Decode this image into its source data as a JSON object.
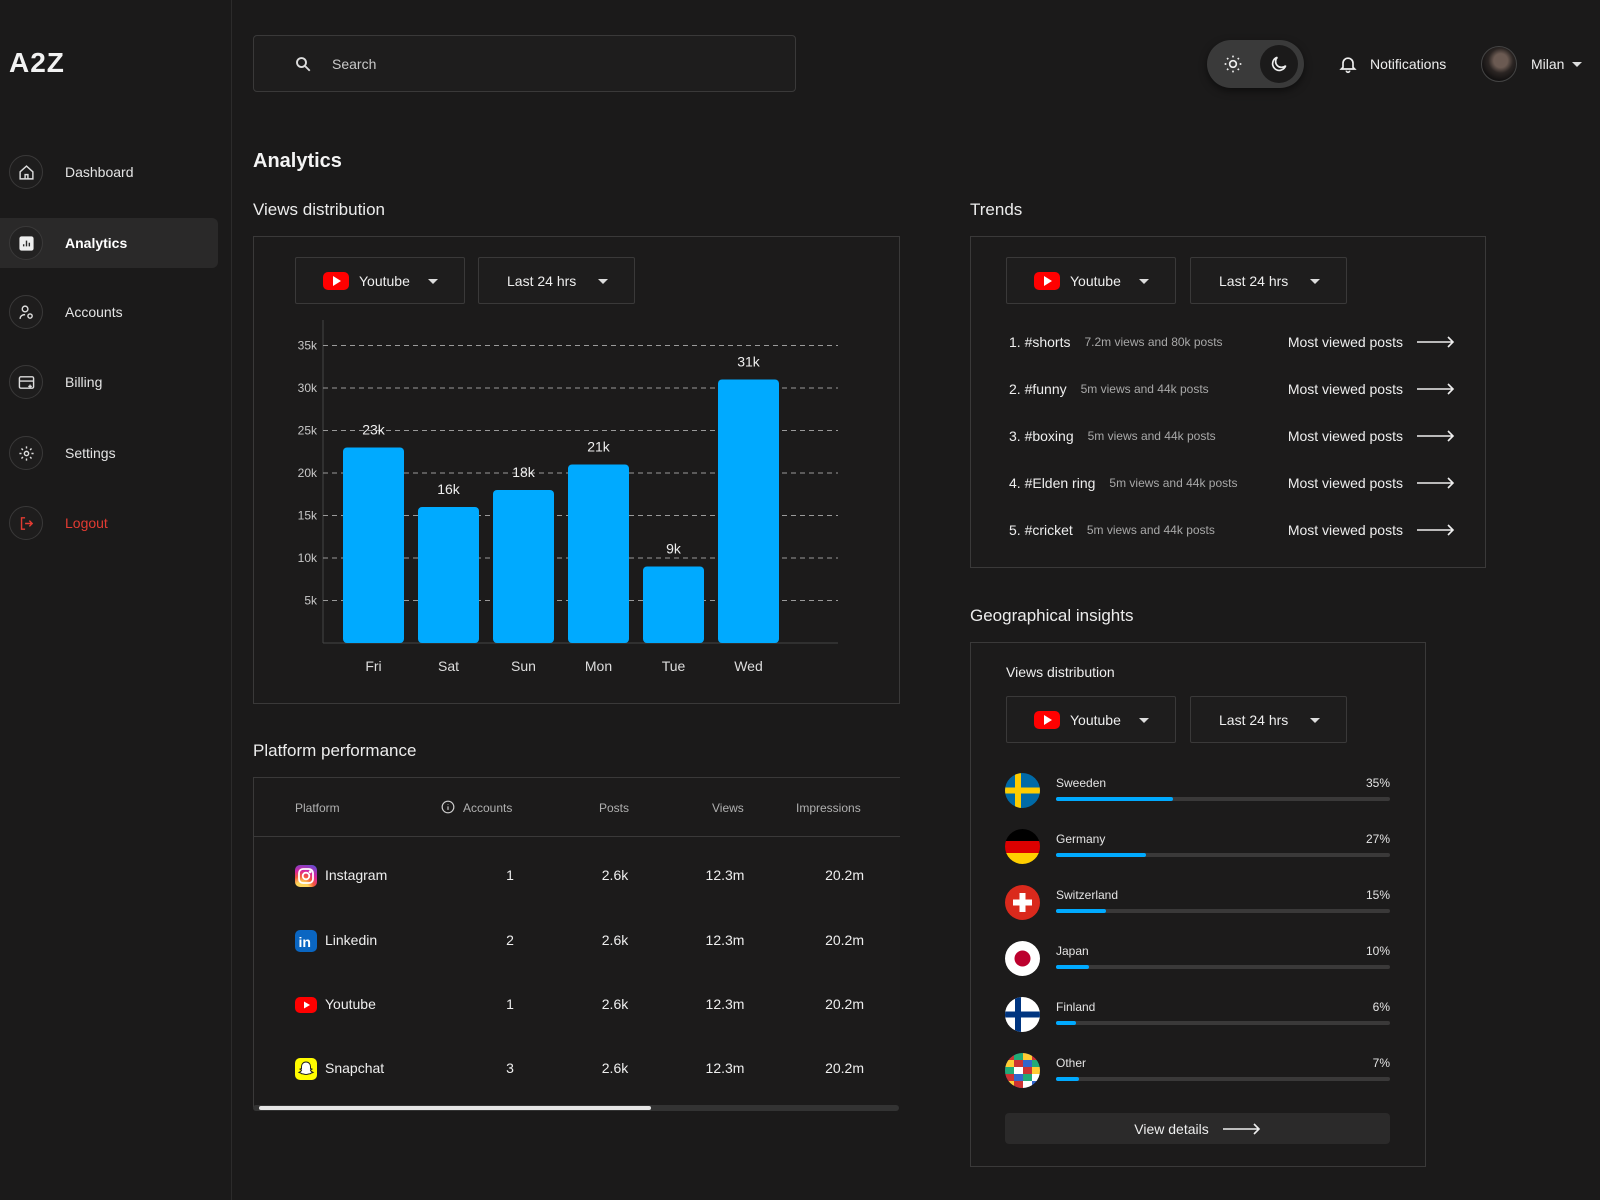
{
  "app": {
    "logo": "A2Z"
  },
  "sidebar": {
    "items": [
      {
        "label": "Dashboard",
        "icon": "home-icon"
      },
      {
        "label": "Analytics",
        "icon": "chart-icon",
        "active": true
      },
      {
        "label": "Accounts",
        "icon": "user-gear-icon"
      },
      {
        "label": "Billing",
        "icon": "card-icon"
      },
      {
        "label": "Settings",
        "icon": "gear-icon"
      },
      {
        "label": "Logout",
        "icon": "logout-icon",
        "color": "#e23b32"
      }
    ]
  },
  "header": {
    "search_placeholder": "Search",
    "notifications_label": "Notifications",
    "user_name": "Milan",
    "theme": "dark"
  },
  "page": {
    "title": "Analytics"
  },
  "views": {
    "title": "Views distribution",
    "platform_select": "Youtube",
    "range_select": "Last 24 hrs"
  },
  "chart_data": {
    "type": "bar",
    "categories": [
      "Fri",
      "Sat",
      "Sun",
      "Mon",
      "Tue",
      "Wed"
    ],
    "values": [
      23,
      16,
      18,
      21,
      9,
      31
    ],
    "data_labels": [
      "23k",
      "16k",
      "18k",
      "21k",
      "9k",
      "31k"
    ],
    "yticks": [
      5,
      10,
      15,
      20,
      25,
      30,
      35
    ],
    "ytick_labels": [
      "5k",
      "10k",
      "15k",
      "20k",
      "25k",
      "30k",
      "35k"
    ],
    "ylim": [
      0,
      38
    ],
    "grid": true,
    "bar_color": "#00aaff"
  },
  "trends": {
    "title": "Trends",
    "platform_select": "Youtube",
    "range_select": "Last 24 hrs",
    "link_label": "Most viewed posts",
    "items": [
      {
        "tag": "1. #shorts",
        "meta": "7.2m views and 80k posts"
      },
      {
        "tag": "2. #funny",
        "meta": "5m views and 44k posts"
      },
      {
        "tag": "3. #boxing",
        "meta": "5m views and 44k posts"
      },
      {
        "tag": "4. #Elden ring",
        "meta": "5m views and 44k posts"
      },
      {
        "tag": "5. #cricket",
        "meta": "5m views and 44k posts"
      }
    ]
  },
  "platform": {
    "title": "Platform performance",
    "headers": [
      "Platform",
      "Accounts",
      "Posts",
      "Views",
      "Impressions"
    ],
    "rows": [
      {
        "name": "Instagram",
        "icon": "instagram-icon",
        "accounts": "1",
        "posts": "2.6k",
        "views": "12.3m",
        "impressions": "20.2m"
      },
      {
        "name": "Linkedin",
        "icon": "linkedin-icon",
        "accounts": "2",
        "posts": "2.6k",
        "views": "12.3m",
        "impressions": "20.2m"
      },
      {
        "name": "Youtube",
        "icon": "youtube-icon",
        "accounts": "1",
        "posts": "2.6k",
        "views": "12.3m",
        "impressions": "20.2m"
      },
      {
        "name": "Snapchat",
        "icon": "snapchat-icon",
        "accounts": "3",
        "posts": "2.6k",
        "views": "12.3m",
        "impressions": "20.2m"
      }
    ]
  },
  "geo": {
    "title": "Geographical insights",
    "subtitle": "Views distribution",
    "platform_select": "Youtube",
    "range_select": "Last 24 hrs",
    "countries": [
      {
        "name": "Sweeden",
        "pct_label": "35%",
        "pct": 35,
        "flag": "sweden-flag"
      },
      {
        "name": "Germany",
        "pct_label": "27%",
        "pct": 27,
        "flag": "germany-flag"
      },
      {
        "name": "Switzerland",
        "pct_label": "15%",
        "pct": 15,
        "flag": "switzerland-flag"
      },
      {
        "name": "Japan",
        "pct_label": "10%",
        "pct": 10,
        "flag": "japan-flag"
      },
      {
        "name": "Finland",
        "pct_label": "6%",
        "pct": 6,
        "flag": "finland-flag"
      },
      {
        "name": "Other",
        "pct_label": "7%",
        "pct": 7,
        "flag": "world-flags-icon"
      }
    ],
    "view_details_label": "View details"
  }
}
